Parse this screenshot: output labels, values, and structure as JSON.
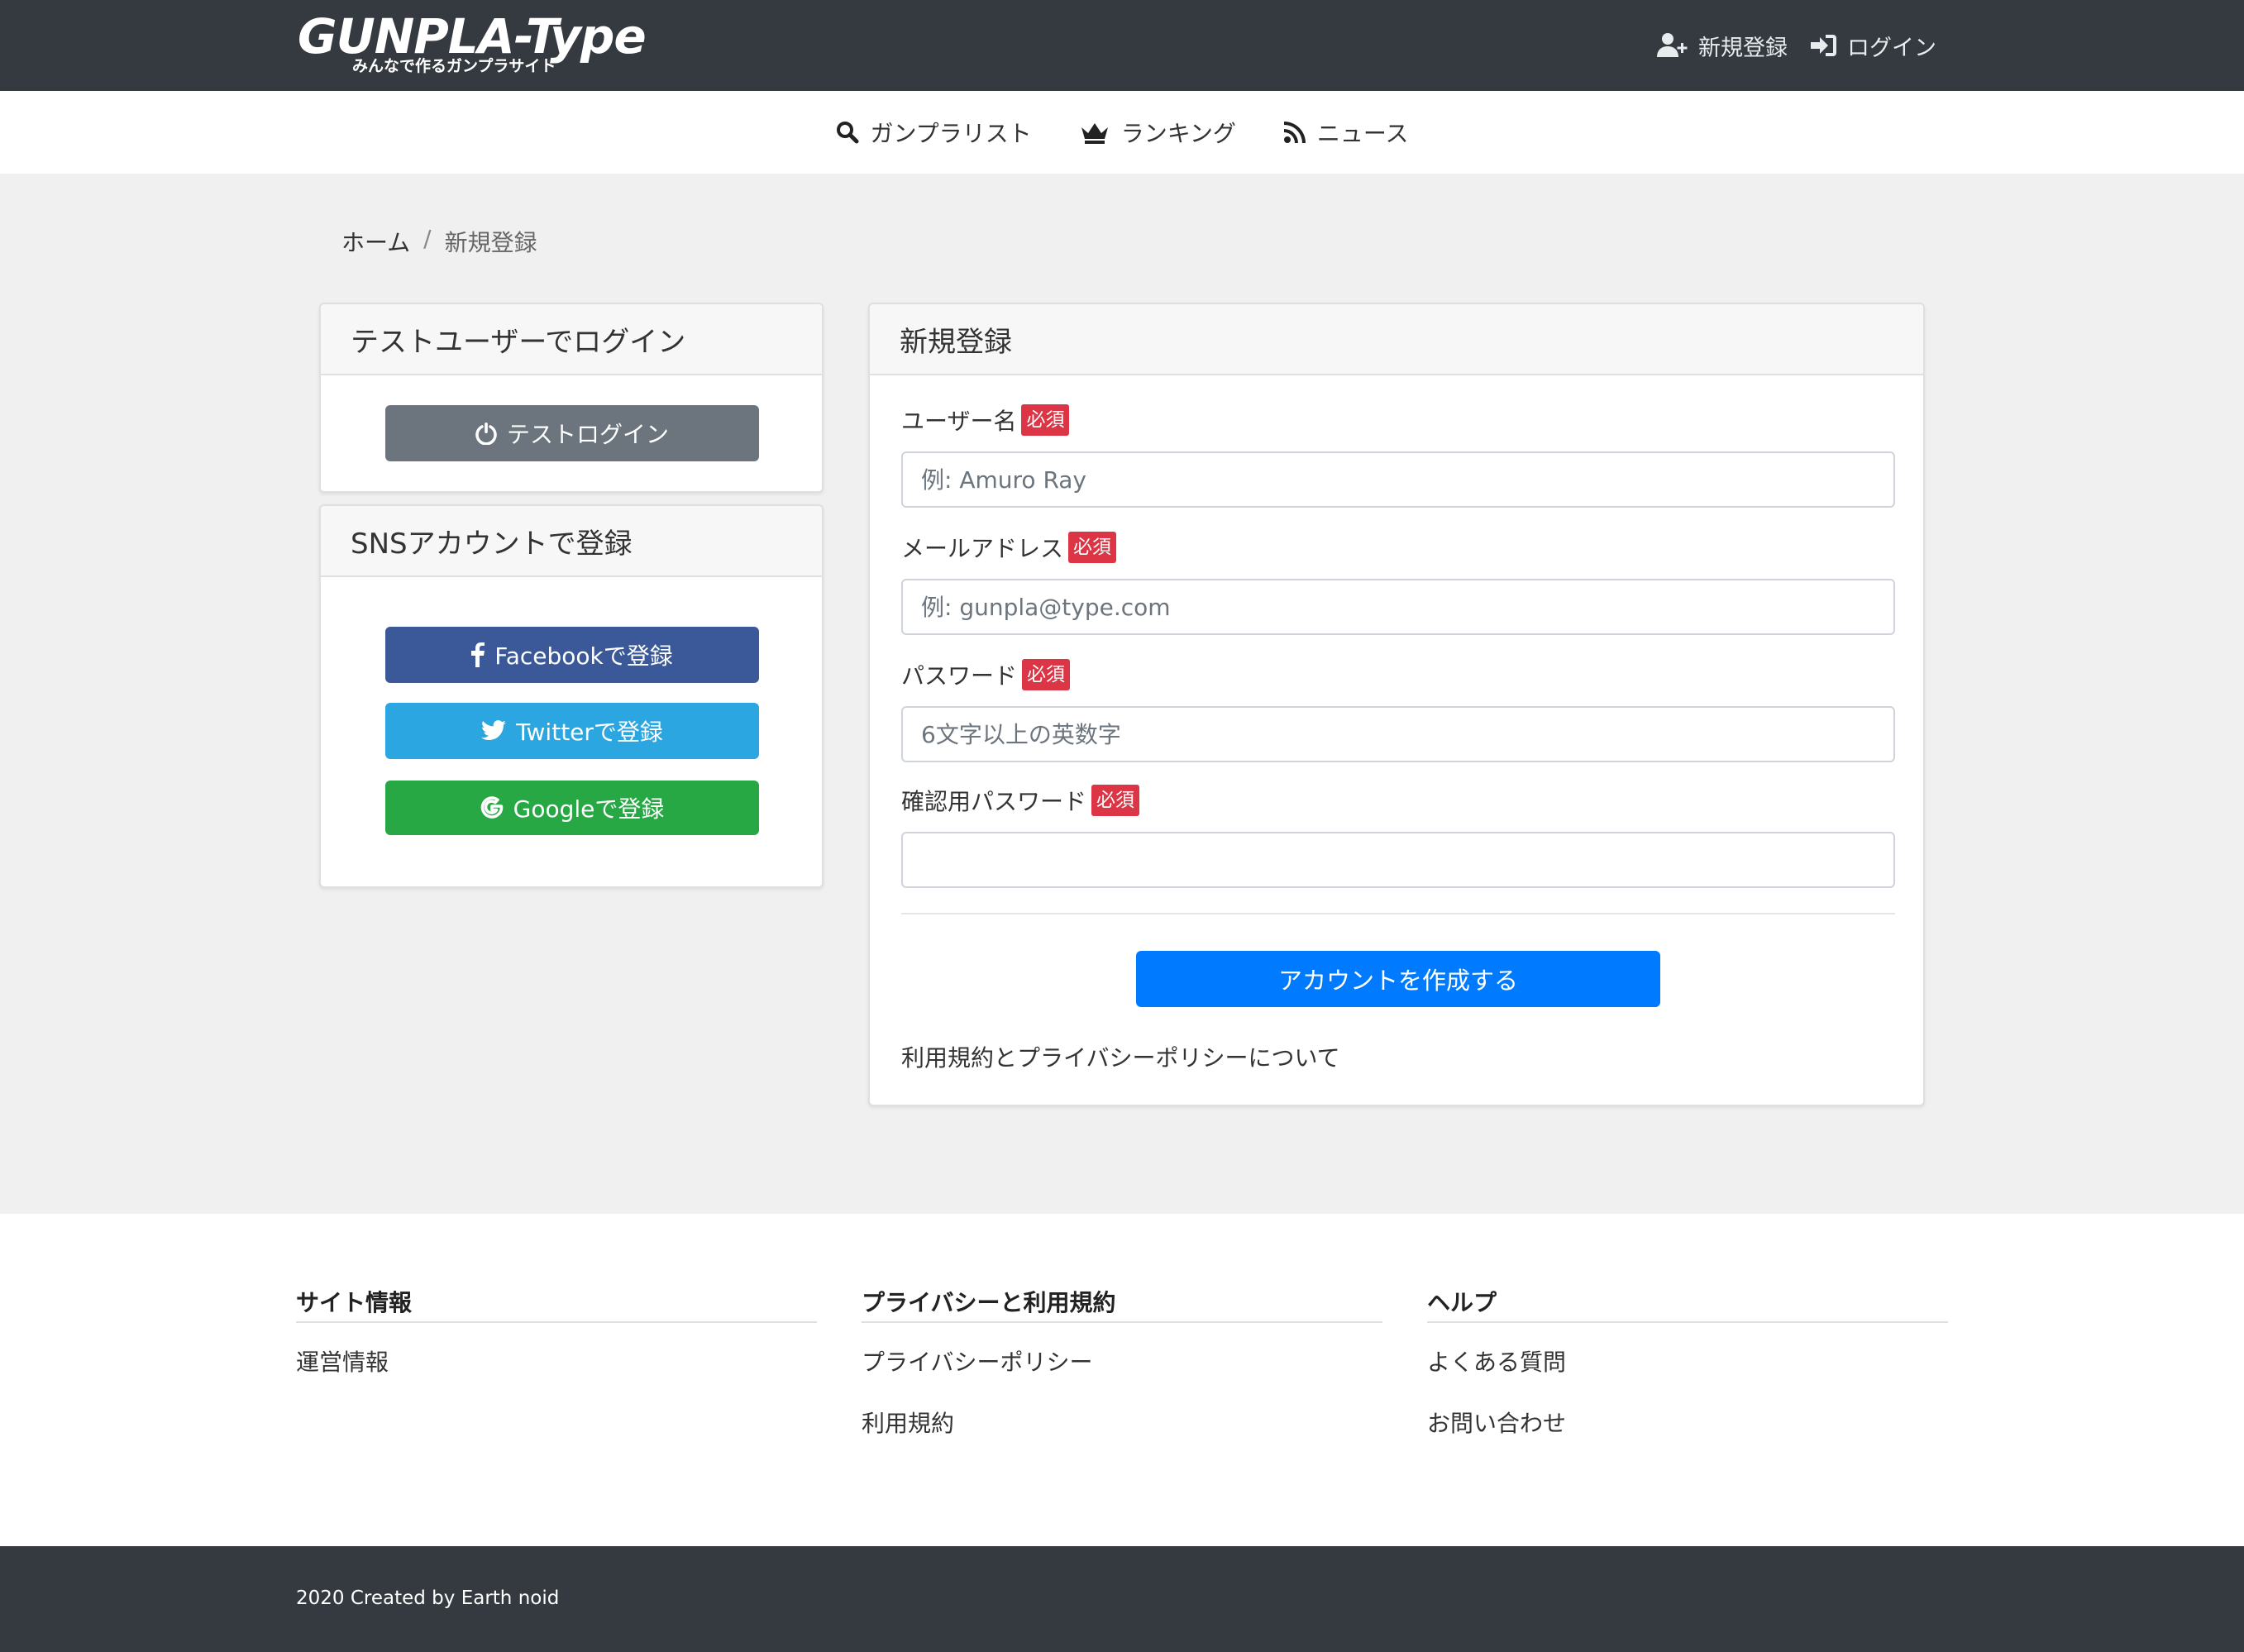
{
  "header": {
    "logo": {
      "main": "GUNPLA-Type",
      "sub": "みんなで作るガンプラサイト"
    },
    "register_label": "新規登録",
    "login_label": "ログイン"
  },
  "nav": {
    "items": [
      {
        "label": "ガンプラリスト",
        "icon": "search-icon"
      },
      {
        "label": "ランキング",
        "icon": "crown-icon"
      },
      {
        "label": "ニュース",
        "icon": "rss-icon"
      }
    ]
  },
  "breadcrumb": {
    "home": "ホーム",
    "separator": "/",
    "current": "新規登録"
  },
  "test_login": {
    "title": "テストユーザーでログイン",
    "button": "テストログイン"
  },
  "sns": {
    "title": "SNSアカウントで登録",
    "facebook": "Facebookで登録",
    "twitter": "Twitterで登録",
    "google": "Googleで登録"
  },
  "register": {
    "title": "新規登録",
    "required_badge": "必須",
    "fields": [
      {
        "label": "ユーザー名",
        "placeholder": "例: Amuro Ray",
        "value": ""
      },
      {
        "label": "メールアドレス",
        "placeholder": "例: gunpla@type.com",
        "value": ""
      },
      {
        "label": "パスワード",
        "placeholder": "6文字以上の英数字",
        "value": ""
      },
      {
        "label": "確認用パスワード",
        "placeholder": "",
        "value": ""
      }
    ],
    "submit": "アカウントを作成する",
    "terms_link": "利用規約とプライバシーポリシーについて"
  },
  "footer": {
    "columns": [
      {
        "title": "サイト情報",
        "links": [
          "運営情報"
        ]
      },
      {
        "title": "プライバシーと利用規約",
        "links": [
          "プライバシーポリシー",
          "利用規約"
        ]
      },
      {
        "title": "ヘルプ",
        "links": [
          "よくある質問",
          "お問い合わせ"
        ]
      }
    ],
    "copyright": "2020 Created by Earth noid"
  },
  "colors": {
    "topbar": "#343a40",
    "required": "#dc3545",
    "primary": "#007bff",
    "facebook": "#3b5998",
    "twitter": "#2ca6e0",
    "google": "#28a745",
    "secondary": "#6c757d"
  }
}
